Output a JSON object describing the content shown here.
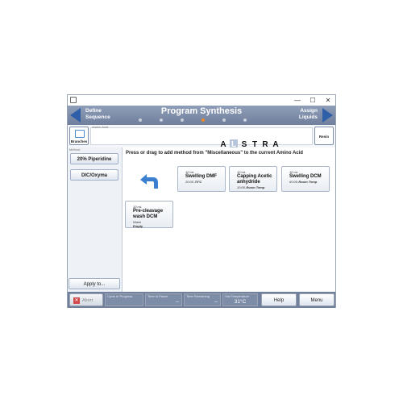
{
  "window": {
    "minimize": "—",
    "maximize": "☐",
    "close": "✕"
  },
  "header": {
    "prev_label": "Define\nSequence",
    "prev_line1": "Define",
    "prev_line2": "Sequence",
    "title": "Program Synthesis",
    "next_line1": "Assign",
    "next_line2": "Liquids",
    "steps_total": 6,
    "active_step": 4,
    "accent_color": "#f28a1f"
  },
  "amino_acid_bar": {
    "branches_label": "Branches",
    "field_label": "Amino Acid",
    "sequence": [
      "A",
      "L",
      "S",
      "T",
      "R",
      "A"
    ],
    "highlighted_index": 1,
    "resin_label": "Resin"
  },
  "method_panel": {
    "label": "Method",
    "buttons": [
      "20% Piperidine",
      "DIC/Oxyma"
    ],
    "apply_label": "Apply to..."
  },
  "main": {
    "instruction": "Press or drag to add method from \"Miscellaneous\" to the current Amino Acid",
    "cards": [
      {
        "volume": "10 mL",
        "name": "Swelling DMF",
        "cond_time": "20:00-",
        "cond_temp": "70°C"
      },
      {
        "volume": "10 mL",
        "name": "Capping Acetic anhydride",
        "cond_time": "10:00-",
        "cond_temp": "Room Temp"
      },
      {
        "volume": "10 mL",
        "name": "Swelling DCM",
        "cond_time": "60:00-",
        "cond_temp": "Room Temp"
      },
      {
        "volume": "10 mL",
        "name": "Pre-cleavage wash DCM",
        "cond_time": "Wash",
        "cond_temp": "Empty"
      }
    ]
  },
  "statusbar": {
    "abort_label": "Abort",
    "cycle_label": "Cycle in Progress",
    "cycle_value": "",
    "pause_label": "Time in Pause",
    "pause_value": "--",
    "remaining_label": "Time Remaining",
    "remaining_value": "--",
    "vial_temp_label": "Vial Temperature",
    "vial_temp_value": "31°C",
    "help_label": "Help",
    "menu_label": "Menu"
  }
}
